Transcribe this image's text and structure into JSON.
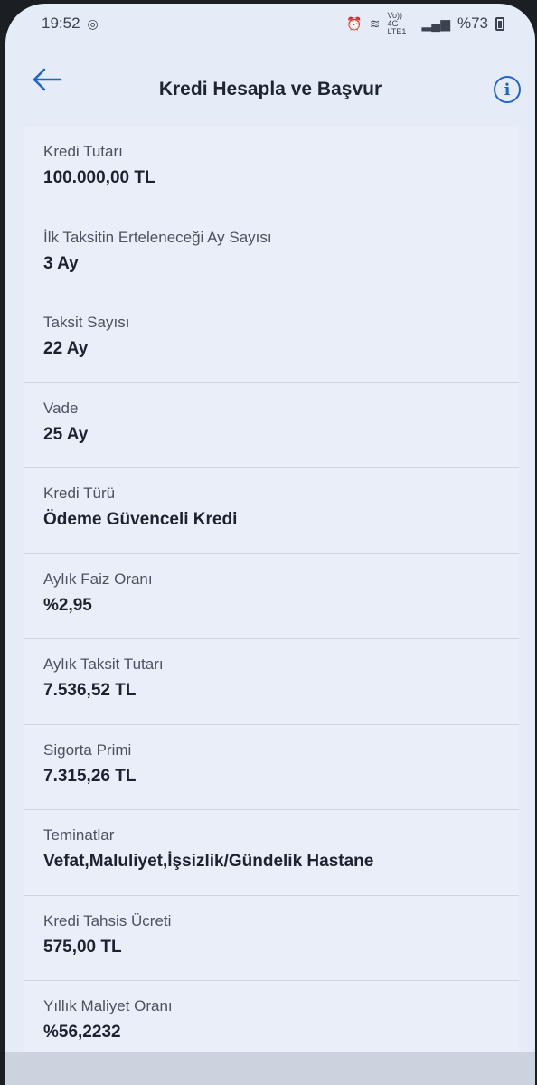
{
  "status_bar": {
    "time": "19:52",
    "network": "Vo)) 4G LTE1",
    "battery": "%73"
  },
  "header": {
    "title": "Kredi Hesapla ve Başvur"
  },
  "details": [
    {
      "label": "Kredi Tutarı",
      "value": "100.000,00 TL"
    },
    {
      "label": "İlk Taksitin Erteleneceği Ay Sayısı",
      "value": "3 Ay"
    },
    {
      "label": "Taksit Sayısı",
      "value": "22 Ay"
    },
    {
      "label": "Vade",
      "value": "25 Ay"
    },
    {
      "label": "Kredi Türü",
      "value": "Ödeme Güvenceli Kredi"
    },
    {
      "label": "Aylık Faiz Oranı",
      "value": "%2,95"
    },
    {
      "label": "Aylık Taksit Tutarı",
      "value": "7.536,52 TL"
    },
    {
      "label": "Sigorta Primi",
      "value": "7.315,26 TL"
    },
    {
      "label": "Teminatlar",
      "value": "Vefat,Maluliyet,İşsizlik/Gündelik Hastane"
    },
    {
      "label": "Kredi Tahsis Ücreti",
      "value": "575,00 TL"
    },
    {
      "label": "Yıllık Maliyet Oranı",
      "value": "%56,2232"
    }
  ],
  "icons": {
    "back": "arrow-left-icon",
    "info": "info-icon",
    "accent_color": "#1e66c8"
  }
}
